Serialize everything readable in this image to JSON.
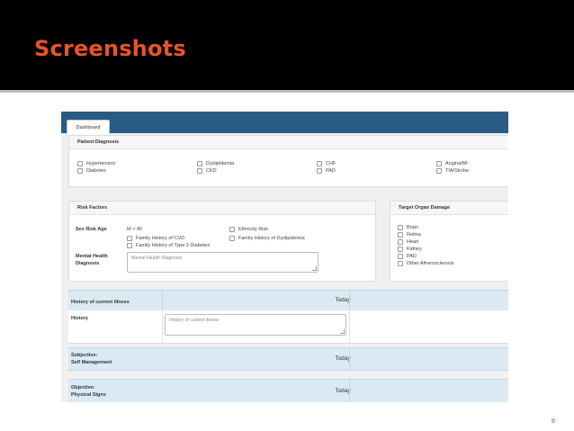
{
  "slide": {
    "title": "Screenshots",
    "page_number": "8"
  },
  "app": {
    "tab_label": "Dashboard",
    "patient_diagnosis": {
      "title": "Patient Diagnosis",
      "items": [
        "Hypertension",
        "Diabetes",
        "Dyslipidemia",
        "CKD",
        "CHF",
        "PAD",
        "Angina/MI",
        "TIA/Stroke"
      ]
    },
    "risk_factors": {
      "title": "Risk Factors",
      "sex_risk_age_label": "Sex Risk Age",
      "sex_risk_age_value": "M > 40",
      "checks": [
        "Family History of CVD",
        "Family History of Type 2 Diabetes",
        "Ethnicity Risk",
        "Family History of Dyslipidemia"
      ],
      "mental_health_label": "Mental Health Diagnosis",
      "mental_health_placeholder": "Mental Health Diagnosis"
    },
    "target_organ_damage": {
      "title": "Target Organ Damage",
      "items": [
        "Brain",
        "Retina",
        "Heart",
        "Kidney",
        "PAD",
        "Other Atherosclerosis"
      ]
    },
    "history_section": {
      "label": "History of current illness",
      "column": "Today",
      "row_label": "History",
      "placeholder": "History of current illness"
    },
    "subjective": {
      "label_line1": "Subjective:",
      "label_line2": "Self Management",
      "column": "Today"
    },
    "objective": {
      "label_line1": "Objective:",
      "label_line2": "Physical Signs",
      "column": "Today"
    }
  }
}
